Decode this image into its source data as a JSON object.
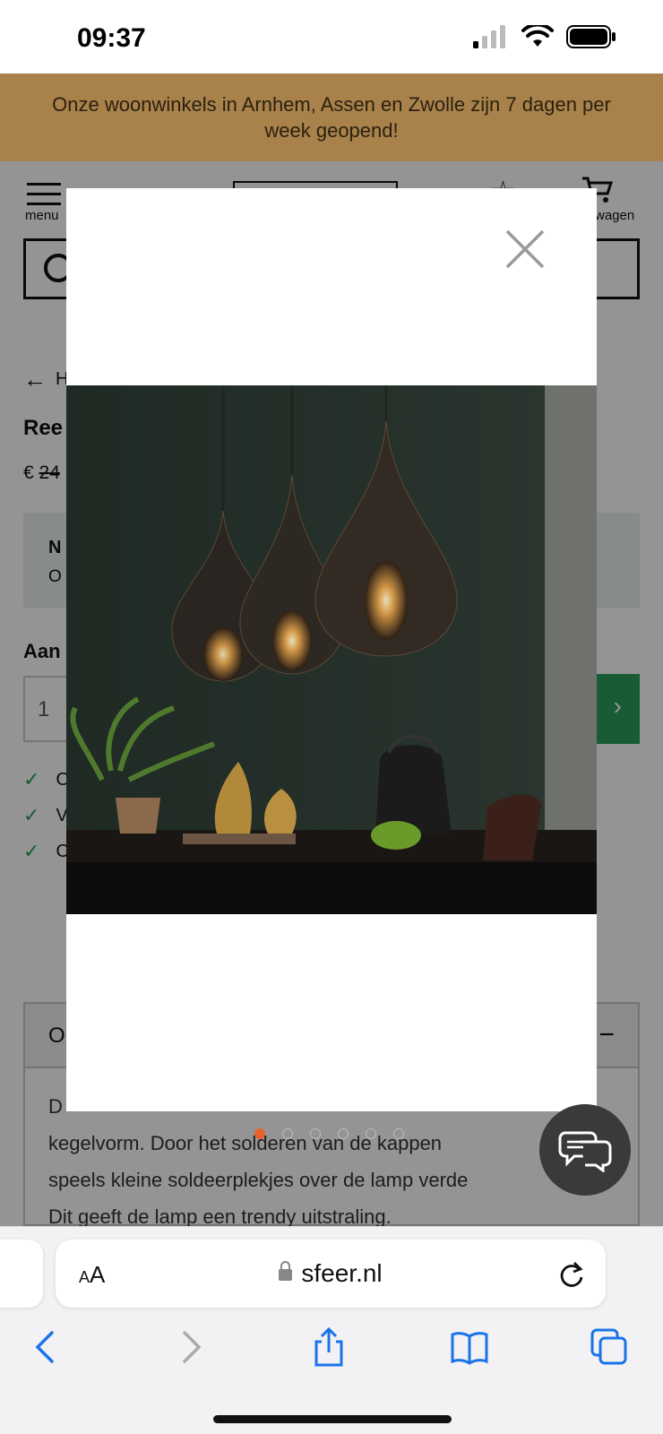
{
  "status_bar": {
    "time": "09:37"
  },
  "promo": {
    "text": "Onze woonwinkels in Arnhem, Assen en Zwolle zijn 7 dagen per week geopend!"
  },
  "header": {
    "menu_label": "menu",
    "cart_label": "wagen"
  },
  "page": {
    "back_label": "H",
    "product_title": "Ree",
    "price_currency": "€",
    "price_old": "24",
    "notice_title": "N",
    "notice_text": "O",
    "qty_label": "Aan",
    "qty_value": "1",
    "usps": [
      "O",
      "V",
      "O"
    ],
    "desc_heading": "O",
    "desc_lines": [
      "D",
      "kegelvorm. Door het solderen van de kappen",
      "speels kleine soldeerplekjes over de lamp verde",
      "Dit geeft de lamp een trendy uitstraling."
    ]
  },
  "gallery": {
    "image_subject": "three pendant lamps above a dining table",
    "slide_count": 6,
    "active_index": 0,
    "accent_color": "#e8622a"
  },
  "browser": {
    "domain": "sfeer.nl",
    "aa_label_small": "A",
    "aa_label_large": "A"
  },
  "icons": [
    "menu-icon",
    "search-icon",
    "star-icon",
    "cart-icon",
    "close-icon",
    "chat-icon",
    "lock-icon",
    "reload-icon",
    "back-icon",
    "forward-icon",
    "share-icon",
    "bookmarks-icon",
    "tabs-icon"
  ]
}
